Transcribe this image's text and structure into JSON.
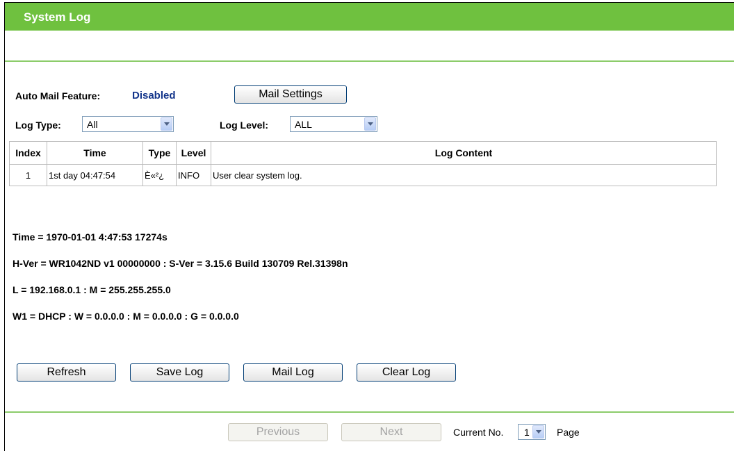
{
  "page": {
    "title": "System Log"
  },
  "mail": {
    "label": "Auto Mail Feature:",
    "status": "Disabled",
    "settings_button": "Mail Settings"
  },
  "filters": {
    "log_type_label": "Log Type:",
    "log_type_value": "All",
    "log_level_label": "Log Level:",
    "log_level_value": "ALL"
  },
  "table": {
    "headers": [
      "Index",
      "Time",
      "Type",
      "Level",
      "Log Content"
    ],
    "rows": [
      {
        "index": "1",
        "time": "1st day 04:47:54",
        "type": "È«²¿",
        "level": "INFO",
        "content": "User clear system log."
      }
    ]
  },
  "info": {
    "time": "Time = 1970-01-01 4:47:53 17274s",
    "hver": "H-Ver = WR1042ND v1 00000000 : S-Ver = 3.15.6 Build 130709 Rel.31398n",
    "lan": "L = 192.168.0.1 : M = 255.255.255.0",
    "wan": "W1 = DHCP : W = 0.0.0.0 : M = 0.0.0.0 : G = 0.0.0.0"
  },
  "actions": {
    "refresh": "Refresh",
    "save": "Save Log",
    "mail": "Mail Log",
    "clear": "Clear Log"
  },
  "pager": {
    "previous": "Previous",
    "next": "Next",
    "current_label": "Current No.",
    "current_value": "1",
    "page_label": "Page"
  }
}
